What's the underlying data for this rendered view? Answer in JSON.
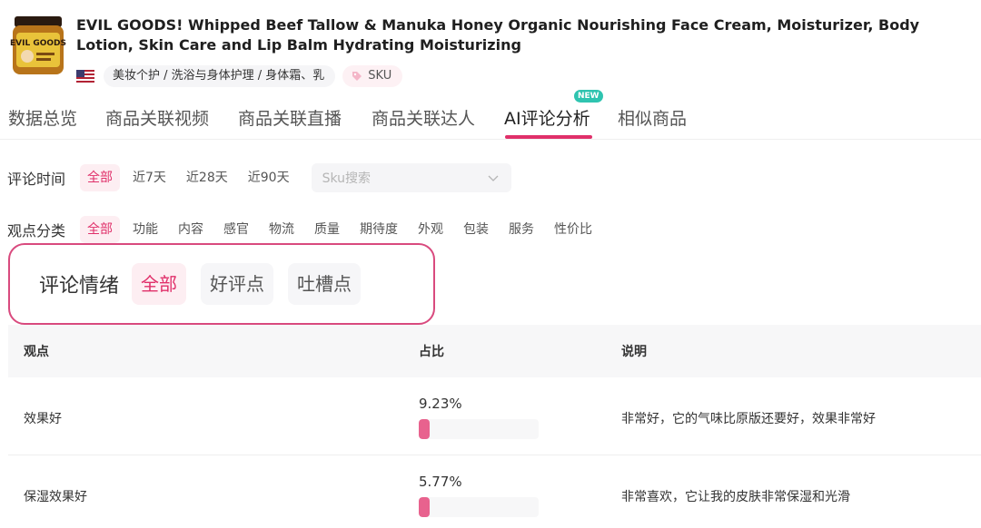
{
  "product": {
    "title": "EVIL GOODS! Whipped Beef Tallow & Manuka Honey Organic Nourishing Face Cream, Moisturizer, Body Lotion, Skin Care and Lip Balm Hydrating Moisturizing",
    "thumb_text": "EVIL GOODS",
    "category": "美妆个护 / 洗浴与身体护理 / 身体霜、乳",
    "sku_label": "SKU"
  },
  "tabs": [
    {
      "label": "数据总览"
    },
    {
      "label": "商品关联视频"
    },
    {
      "label": "商品关联直播"
    },
    {
      "label": "商品关联达人"
    },
    {
      "label": "AI评论分析",
      "active": true,
      "badge": "NEW"
    },
    {
      "label": "相似商品"
    }
  ],
  "filters": {
    "time": {
      "label": "评论时间",
      "options": [
        "全部",
        "近7天",
        "近28天",
        "近90天"
      ],
      "active_index": 0,
      "sku_placeholder": "Sku搜索"
    },
    "category": {
      "label": "观点分类",
      "options": [
        "全部",
        "功能",
        "内容",
        "感官",
        "物流",
        "质量",
        "期待度",
        "外观",
        "包装",
        "服务",
        "性价比"
      ],
      "active_index": 0
    },
    "sentiment": {
      "label": "评论情绪",
      "options": [
        "全部",
        "好评点",
        "吐槽点"
      ],
      "active_index": 0
    }
  },
  "table": {
    "headers": {
      "point": "观点",
      "ratio": "占比",
      "desc": "说明"
    },
    "rows": [
      {
        "point": "效果好",
        "ratio": "9.23%",
        "fill": 0.0923,
        "desc": "非常好，它的气味比原版还要好，效果非常好"
      },
      {
        "point": "保湿效果好",
        "ratio": "5.77%",
        "fill": 0.0577,
        "desc": "非常喜欢，它让我的皮肤非常保湿和光滑"
      }
    ]
  },
  "colors": {
    "accent": "#e0306a",
    "badge": "#2fc4b0",
    "bar": "#e8628e"
  }
}
